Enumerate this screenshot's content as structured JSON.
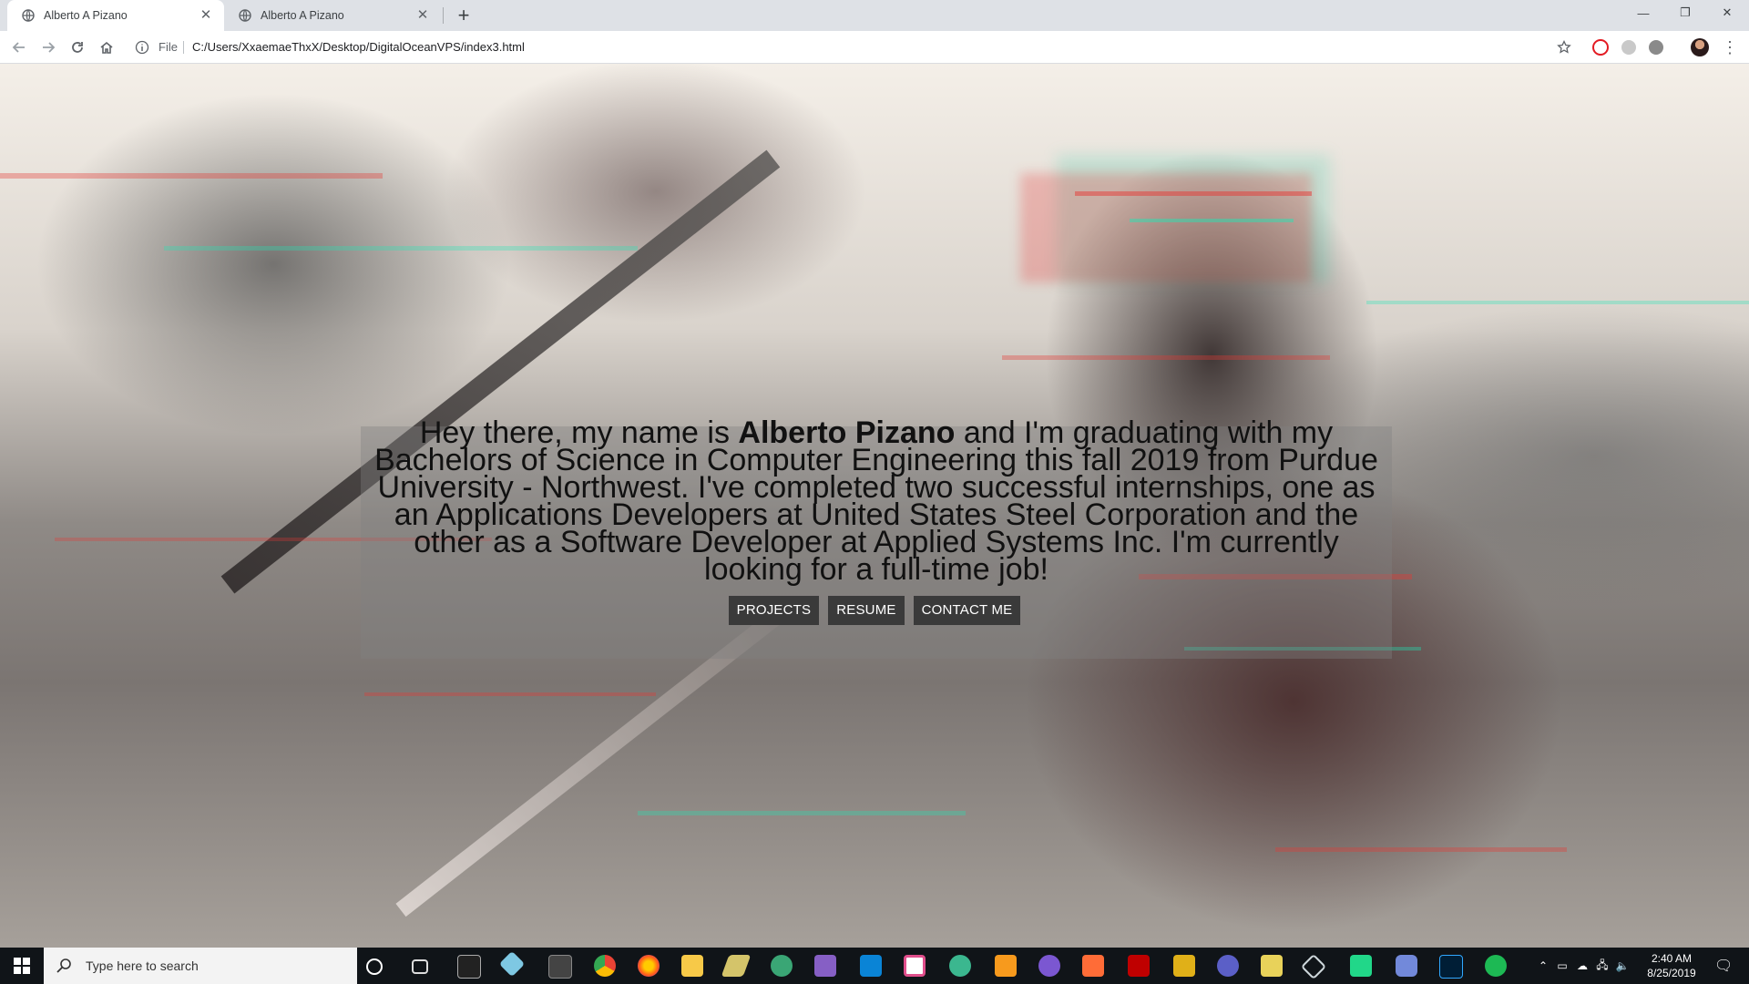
{
  "browser": {
    "tabs": [
      {
        "title": "Alberto A Pizano",
        "active": true
      },
      {
        "title": "Alberto A Pizano",
        "active": false
      }
    ],
    "omnibox": {
      "scheme_label": "File",
      "url": "C:/Users/XxaemaeThxX/Desktop/DigitalOceanVPS/index3.html"
    }
  },
  "page": {
    "intro_prefix": "Hey there, my name is ",
    "intro_name": "Alberto Pizano",
    "intro_rest": " and I'm graduating with my Bachelors of Science in Computer Engineering this fall 2019 from Purdue University - Northwest. I've completed two successful internships, one as an Applications Developers at United States Steel Corporation and the other as a Software Developer at Applied Systems Inc. I'm currently looking for a full-time job!",
    "buttons": {
      "projects": "PROJECTS",
      "resume": "RESUME",
      "contact": "CONTACT ME"
    }
  },
  "taskbar": {
    "search_placeholder": "Type here to search",
    "time": "2:40 AM",
    "date": "8/25/2019",
    "pinned_icons": [
      "cortana-icon",
      "task-view-icon",
      "terminal-icon",
      "git-icon",
      "window-icon",
      "chrome-icon",
      "firefox-icon",
      "file-explorer-icon",
      "pencil-icon",
      "gitkraken-icon",
      "visual-studio-icon",
      "vscode-icon",
      "intellij-icon",
      "gitkraken-alt-icon",
      "sublime-icon",
      "app-icon",
      "postman-icon",
      "filezilla-icon",
      "folder-sync-icon",
      "vpn-icon",
      "notes-icon",
      "cube-icon",
      "pycharm-icon",
      "discord-icon",
      "photoshop-icon",
      "spotify-icon"
    ]
  }
}
